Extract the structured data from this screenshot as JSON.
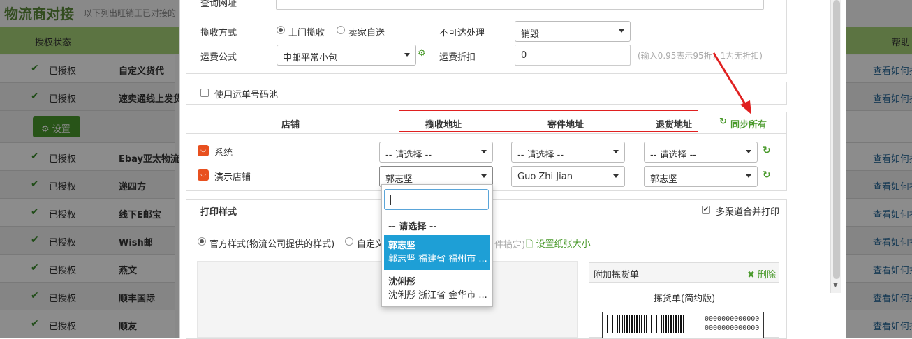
{
  "background": {
    "title": "物流商对接",
    "subtitle": "以下列出旺销王已对接的",
    "headers": {
      "status": "授权状态",
      "help": "帮助"
    },
    "setting_button": "设置",
    "rows": [
      {
        "status": "已授权",
        "name": "自定义货代",
        "help": "查看如何授"
      },
      {
        "status": "已授权",
        "name": "速卖通线上发货",
        "help": "查看如何授"
      },
      {
        "status": "已授权",
        "name": "Ebay亚太物流",
        "help": "查看如何授"
      },
      {
        "status": "已授权",
        "name": "递四方",
        "help": "查看如何授"
      },
      {
        "status": "已授权",
        "name": "线下E邮宝",
        "help": "查看如何授"
      },
      {
        "status": "已授权",
        "name": "Wish邮",
        "help": "查看如何授"
      },
      {
        "status": "已授权",
        "name": "燕文",
        "help": "查看如何授"
      },
      {
        "status": "已授权",
        "name": "顺丰国际",
        "help": "查看如何授"
      },
      {
        "status": "已授权",
        "name": "顺友",
        "help": "查看如何授"
      }
    ]
  },
  "form": {
    "query_url_label": "查询网址",
    "pickup_method_label": "揽收方式",
    "pickup_options": [
      "上门揽收",
      "卖家自送"
    ],
    "pickup_selected": "上门揽收",
    "unreachable_label": "不可达处理",
    "unreachable_value": "销毁",
    "freight_formula_label": "运费公式",
    "freight_formula_value": "中邮平常小包",
    "freight_discount_label": "运费折扣",
    "freight_discount_value": "0",
    "freight_discount_hint": "(输入0.95表示95折，1为无折扣)",
    "waybill_pool_label": "使用运单号码池",
    "waybill_pool_checked": false
  },
  "address_table": {
    "headers": {
      "shop": "店铺",
      "pickup": "揽收地址",
      "sender": "寄件地址",
      "return": "退货地址"
    },
    "sync_all": "同步所有",
    "rows": [
      {
        "shop": "系统",
        "pickup": "-- 请选择 --",
        "sender": "-- 请选择 --",
        "return": "-- 请选择 --"
      },
      {
        "shop": "演示店铺",
        "pickup": "郭志坚",
        "sender": "Guo Zhi Jian",
        "return": "郭志坚"
      }
    ]
  },
  "dropdown": {
    "search_value": "",
    "placeholder_option": "-- 请选择 --",
    "options": [
      {
        "name": "郭志坚",
        "detail": "郭志坚 福建省 福州市 ...",
        "highlighted": true
      },
      {
        "name": "沈俐彤",
        "detail": "沈俐彤 浙江省 金华市 ...",
        "highlighted": false
      }
    ]
  },
  "print_style": {
    "title": "打印样式",
    "multi_channel_label": "多渠道合并打印",
    "multi_channel_checked": true,
    "style_options": [
      "官方样式(物流公司提供的样式)",
      "自定义"
    ],
    "style_selected": "官方样式(物流公司提供的样式)",
    "partial_hint": "件搞定)",
    "paper_size_link": "设置纸张大小",
    "pick_panel_title": "附加拣货单",
    "pick_delete": "删除",
    "pick_doc_title": "拣货单(简约版)",
    "barcode_numbers": [
      "0000000000000",
      "0000000000000"
    ]
  },
  "colors": {
    "accent": "#4a9a2c",
    "highlight": "#1e9fd6",
    "annotation": "#e02020"
  }
}
